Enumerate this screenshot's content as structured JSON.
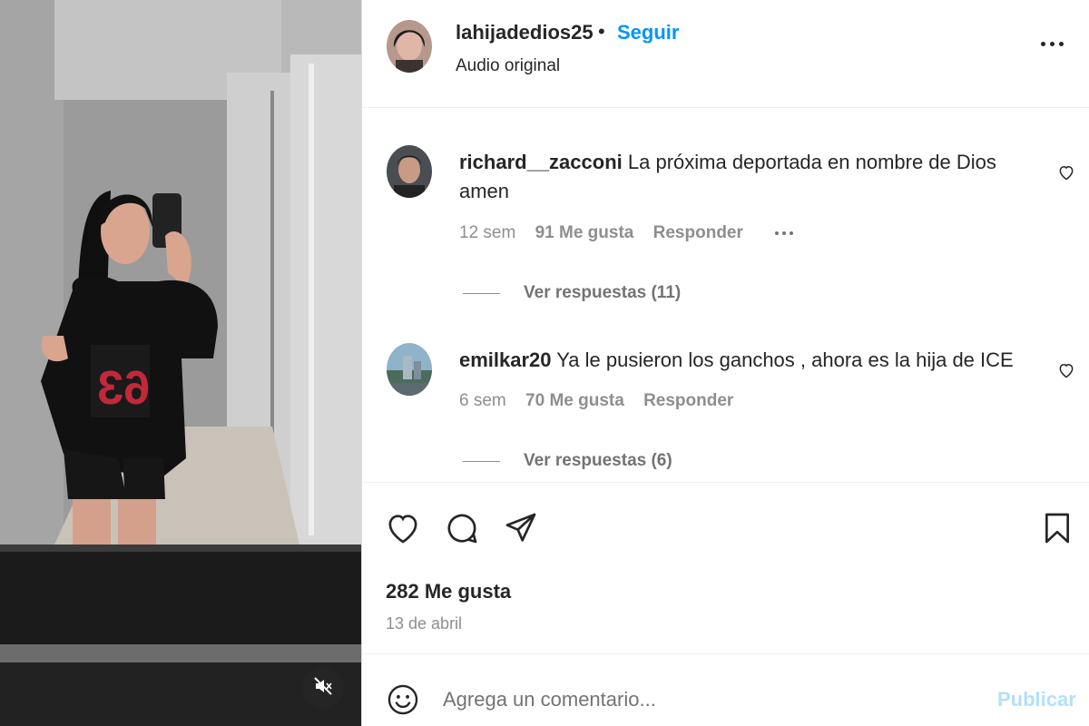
{
  "post": {
    "author": "lahijadedios25",
    "dot": "•",
    "follow_label": "Seguir",
    "audio_label": "Audio original",
    "more_icon": "more-horizontal-icon"
  },
  "media": {
    "mute_icon": "speaker-muted-icon"
  },
  "comments": [
    {
      "username": "richard__zacconi",
      "text": "La próxima deportada en nombre de Dios amen",
      "age": "12 sem",
      "likes": "91 Me gusta",
      "reply_label": "Responder",
      "view_replies": "Ver respuestas (11)"
    },
    {
      "username": "emilkar20",
      "text": "Ya le pusieron los ganchos , ahora es la hija de ICE",
      "age": "6 sem",
      "likes": "70 Me gusta",
      "reply_label": "Responder",
      "view_replies": "Ver respuestas (6)"
    }
  ],
  "actions": {
    "like_icon": "heart-icon",
    "comment_icon": "comment-icon",
    "share_icon": "send-icon",
    "save_icon": "bookmark-icon",
    "likes_count": "282 Me gusta",
    "date": "13 de abril"
  },
  "composer": {
    "emoji_icon": "emoji-icon",
    "placeholder": "Agrega un comentario...",
    "publish_label": "Publicar"
  },
  "colors": {
    "accent": "#0095f6",
    "publish_disabled": "#b2dffc",
    "text": "#262626",
    "muted": "#8e8e8e"
  }
}
